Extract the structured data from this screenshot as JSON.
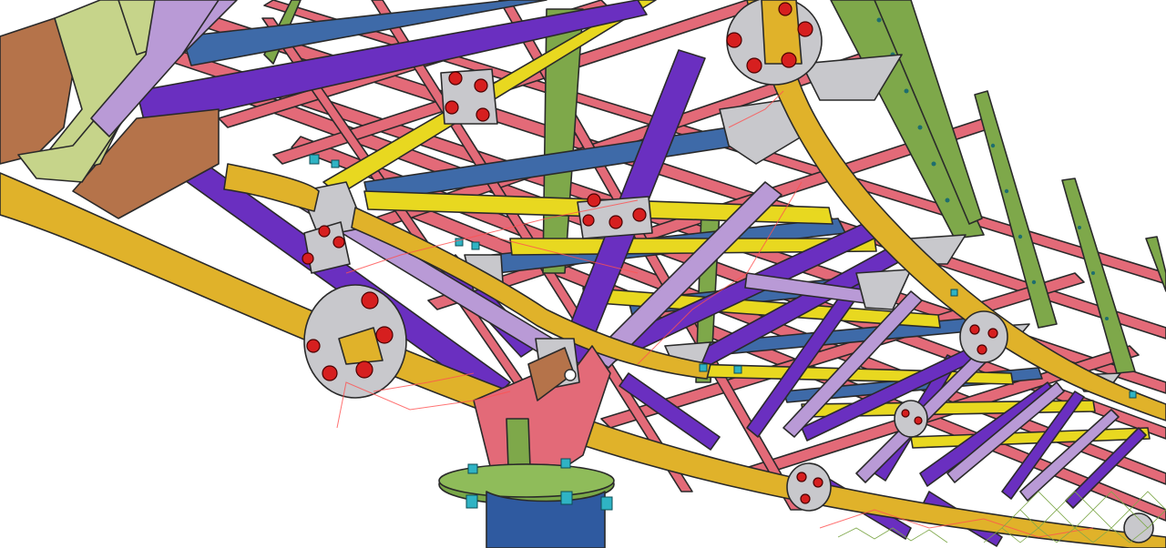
{
  "view": {
    "colors": {
      "background": "#ffffff",
      "main_chord": "#e0b22a",
      "lattice": "#e36a78",
      "diagonal_violet": "#6a2fc0",
      "diagonal_lilac": "#b99ad6",
      "purlin_blue": "#3e6aa8",
      "purlin_yellow": "#e8d820",
      "stiffener_green": "#7ea84a",
      "plate_grey": "#c8c8cc",
      "bolt_red": "#d61f1f",
      "nut_cyan": "#2fb3c4",
      "column_blue": "#2f5aa0",
      "column_flange_green": "#7aa848",
      "bracket_brown": "#b5734a",
      "bracket_olive": "#c6d48a"
    }
  }
}
